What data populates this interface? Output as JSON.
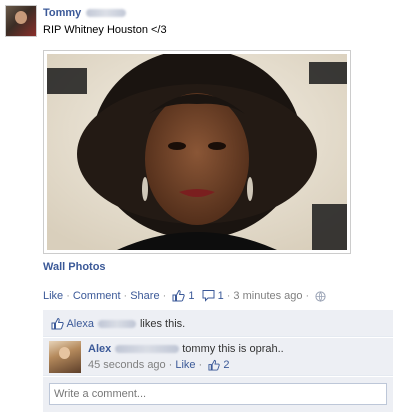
{
  "post": {
    "author_first_name": "Tommy",
    "message": "RIP Whitney Houston </3",
    "photo_caption": "Wall Photos",
    "actions": {
      "like": "Like",
      "comment": "Comment",
      "share": "Share",
      "like_count": "1",
      "comment_count": "1",
      "time": "3 minutes ago"
    }
  },
  "likes": {
    "first_name": "Alexa",
    "suffix": "likes this."
  },
  "comments": [
    {
      "author_first_name": "Alex",
      "text": "tommy this is oprah..",
      "time": "45 seconds ago",
      "like": "Like",
      "like_count": "2"
    }
  ],
  "write_comment": {
    "placeholder": "Write a comment..."
  },
  "icons": {
    "thumbs_up": "thumbs-up-icon",
    "comment_bubble": "comment-bubble-icon",
    "globe": "globe-icon"
  },
  "colors": {
    "link": "#3b5998",
    "panel_bg": "#edeff4",
    "meta_gray": "#808080"
  }
}
